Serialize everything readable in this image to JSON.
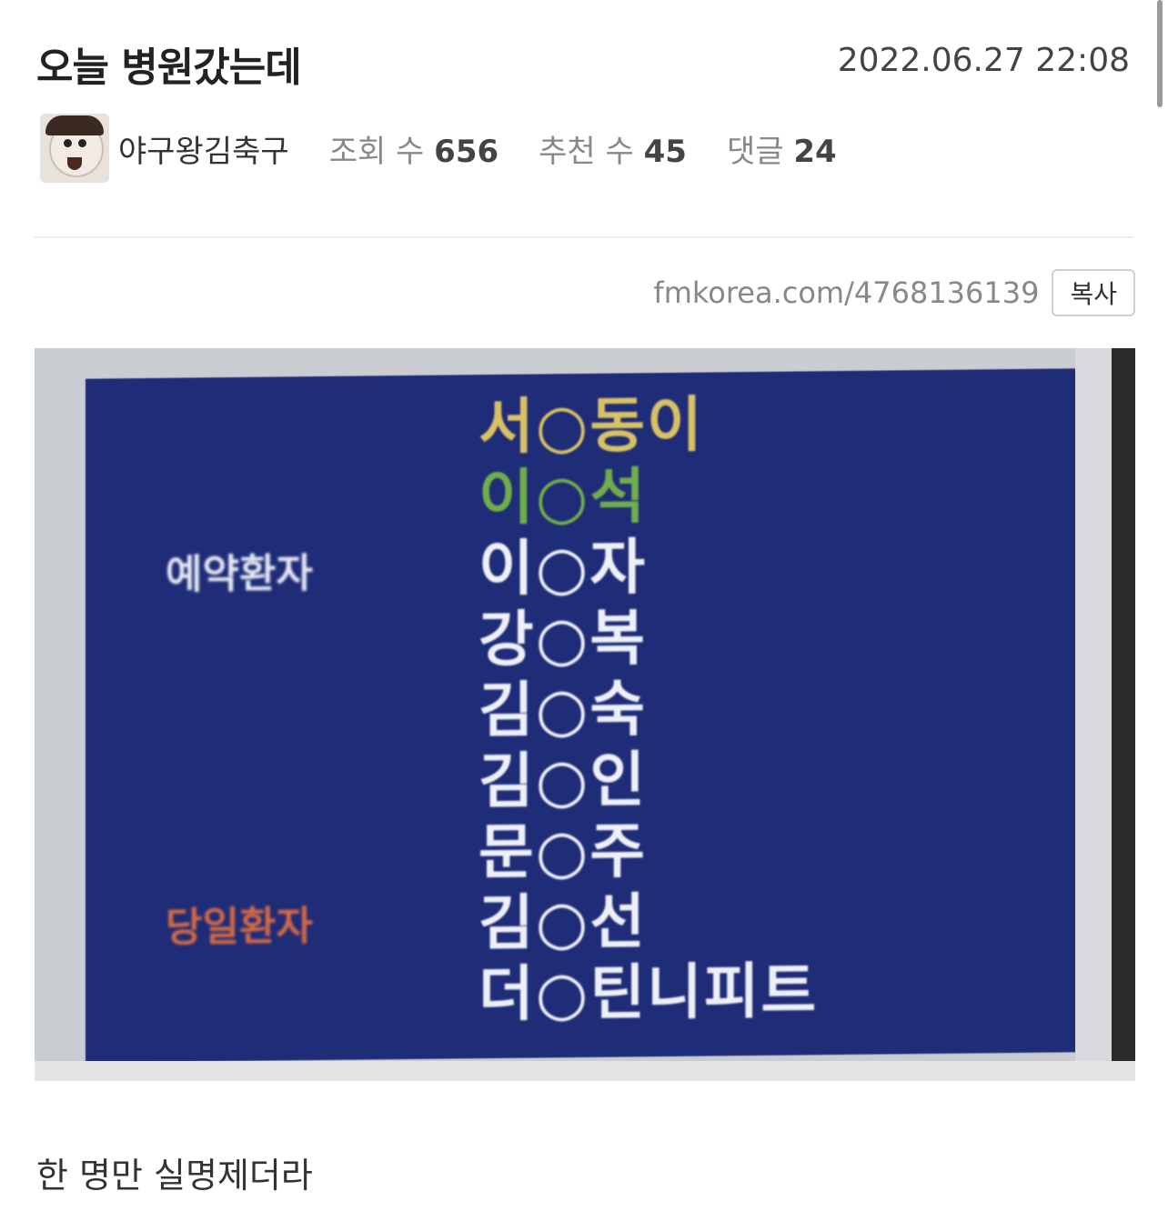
{
  "post": {
    "title": "오늘 병원갔는데",
    "date": "2022.06.27 22:08",
    "author": "야구왕김축구",
    "views_label": "조회 수",
    "views": "656",
    "recommend_label": "추천 수",
    "recommend": "45",
    "comments_label": "댓글",
    "comments": "24",
    "url": "fmkorea.com/4768136139",
    "copy_label": "복사",
    "caption": "한 명만 실명제더라"
  },
  "board": {
    "reserved_label": "예약환자",
    "other_label": "당일환자",
    "names": [
      "서○동이",
      "이○석",
      "이○자",
      "강○복",
      "김○숙",
      "김○인",
      "문○주",
      "김○선",
      "더○틴니피트"
    ],
    "colors": {
      "background": "#1f2c78",
      "highlight_yellow": "#d8c264",
      "highlight_green": "#6fae4a",
      "label_red": "#d46a45"
    }
  }
}
